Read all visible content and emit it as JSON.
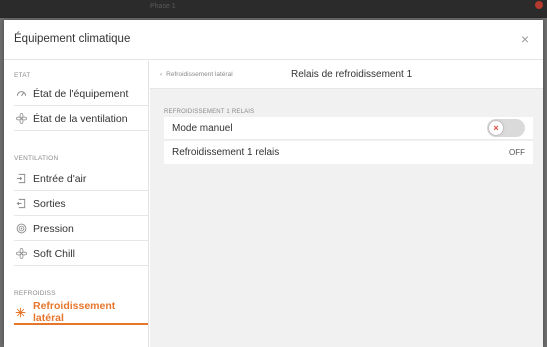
{
  "background_bar": {
    "ghost_title": "Phase 1"
  },
  "modal": {
    "title": "Équipement climatique",
    "close_glyph": "×"
  },
  "sidebar": {
    "sections": [
      {
        "label": "ETAT",
        "items": [
          {
            "label": "État de l'équipement",
            "icon": "gauge-icon"
          },
          {
            "label": "État de la ventilation",
            "icon": "fan-icon"
          }
        ]
      },
      {
        "label": "VENTILATION",
        "items": [
          {
            "label": "Entrée d'air",
            "icon": "air-inlet-icon"
          },
          {
            "label": "Sorties",
            "icon": "exit-icon"
          },
          {
            "label": "Pression",
            "icon": "pressure-icon"
          },
          {
            "label": "Soft Chill",
            "icon": "fan-icon"
          }
        ]
      },
      {
        "label": "REFROIDISS",
        "items": [
          {
            "label": "Refroidissement latéral",
            "icon": "cooling-icon",
            "active": true
          }
        ]
      }
    ]
  },
  "content": {
    "breadcrumb_back": "Refroidissement latéral",
    "title": "Relais de refroidissement 1",
    "group_label": "REFROIDISSEMENT 1 RELAIS",
    "rows": [
      {
        "label": "Mode manuel",
        "control": "toggle",
        "state": "off",
        "toggle_glyph": "×"
      },
      {
        "label": "Refroidissement 1 relais",
        "value": "OFF"
      }
    ]
  },
  "colors": {
    "accent": "#e7762c",
    "toggle_off_mark": "#e0443a",
    "content_bg": "#f1f1f1"
  }
}
